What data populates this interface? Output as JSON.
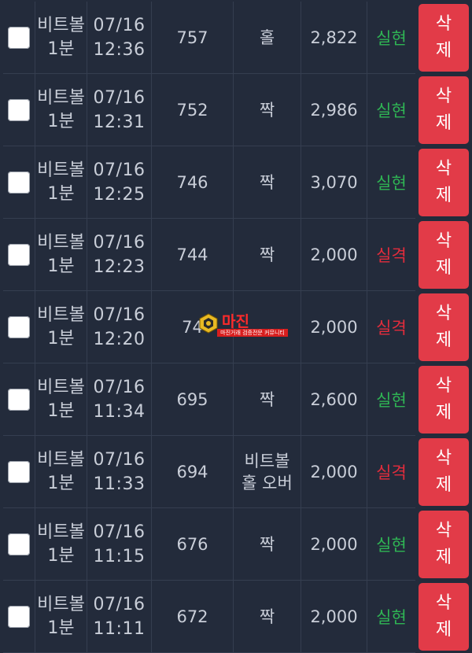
{
  "rows": [
    {
      "game": "비트볼\n1분",
      "date": "07/16",
      "time": "12:36",
      "round": "757",
      "pick": "홀",
      "amount": "2,822",
      "result": "실현",
      "result_type": "win",
      "delete_top": "삭",
      "delete_bottom": "제"
    },
    {
      "game": "비트볼\n1분",
      "date": "07/16",
      "time": "12:31",
      "round": "752",
      "pick": "짝",
      "amount": "2,986",
      "result": "실현",
      "result_type": "win",
      "delete_top": "삭",
      "delete_bottom": "제"
    },
    {
      "game": "비트볼\n1분",
      "date": "07/16",
      "time": "12:25",
      "round": "746",
      "pick": "짝",
      "amount": "3,070",
      "result": "실현",
      "result_type": "win",
      "delete_top": "삭",
      "delete_bottom": "제"
    },
    {
      "game": "비트볼\n1분",
      "date": "07/16",
      "time": "12:23",
      "round": "744",
      "pick": "짝",
      "amount": "2,000",
      "result": "실격",
      "result_type": "lose",
      "delete_top": "삭",
      "delete_bottom": "제"
    },
    {
      "game": "비트볼\n1분",
      "date": "07/16",
      "time": "12:20",
      "round": "74",
      "pick": "",
      "amount": "2,000",
      "result": "실격",
      "result_type": "lose",
      "delete_top": "삭",
      "delete_bottom": "제"
    },
    {
      "game": "비트볼\n1분",
      "date": "07/16",
      "time": "11:34",
      "round": "695",
      "pick": "짝",
      "amount": "2,600",
      "result": "실현",
      "result_type": "win",
      "delete_top": "삭",
      "delete_bottom": "제"
    },
    {
      "game": "비트볼\n1분",
      "date": "07/16",
      "time": "11:33",
      "round": "694",
      "pick": "비트볼\n홀 오버",
      "amount": "2,000",
      "result": "실격",
      "result_type": "lose",
      "delete_top": "삭",
      "delete_bottom": "제"
    },
    {
      "game": "비트볼\n1분",
      "date": "07/16",
      "time": "11:15",
      "round": "676",
      "pick": "짝",
      "amount": "2,000",
      "result": "실현",
      "result_type": "win",
      "delete_top": "삭",
      "delete_bottom": "제"
    },
    {
      "game": "비트볼\n1분",
      "date": "07/16",
      "time": "11:11",
      "round": "672",
      "pick": "짝",
      "amount": "2,000",
      "result": "실현",
      "result_type": "win",
      "delete_top": "삭",
      "delete_bottom": "제"
    }
  ],
  "watermark": {
    "name": "마진",
    "tagline": "마진거래 검증전문 커뮤니티"
  },
  "colors": {
    "background": "#232b3b",
    "win": "#2fb554",
    "lose": "#e22c3c",
    "delete_button": "#e23b48"
  }
}
